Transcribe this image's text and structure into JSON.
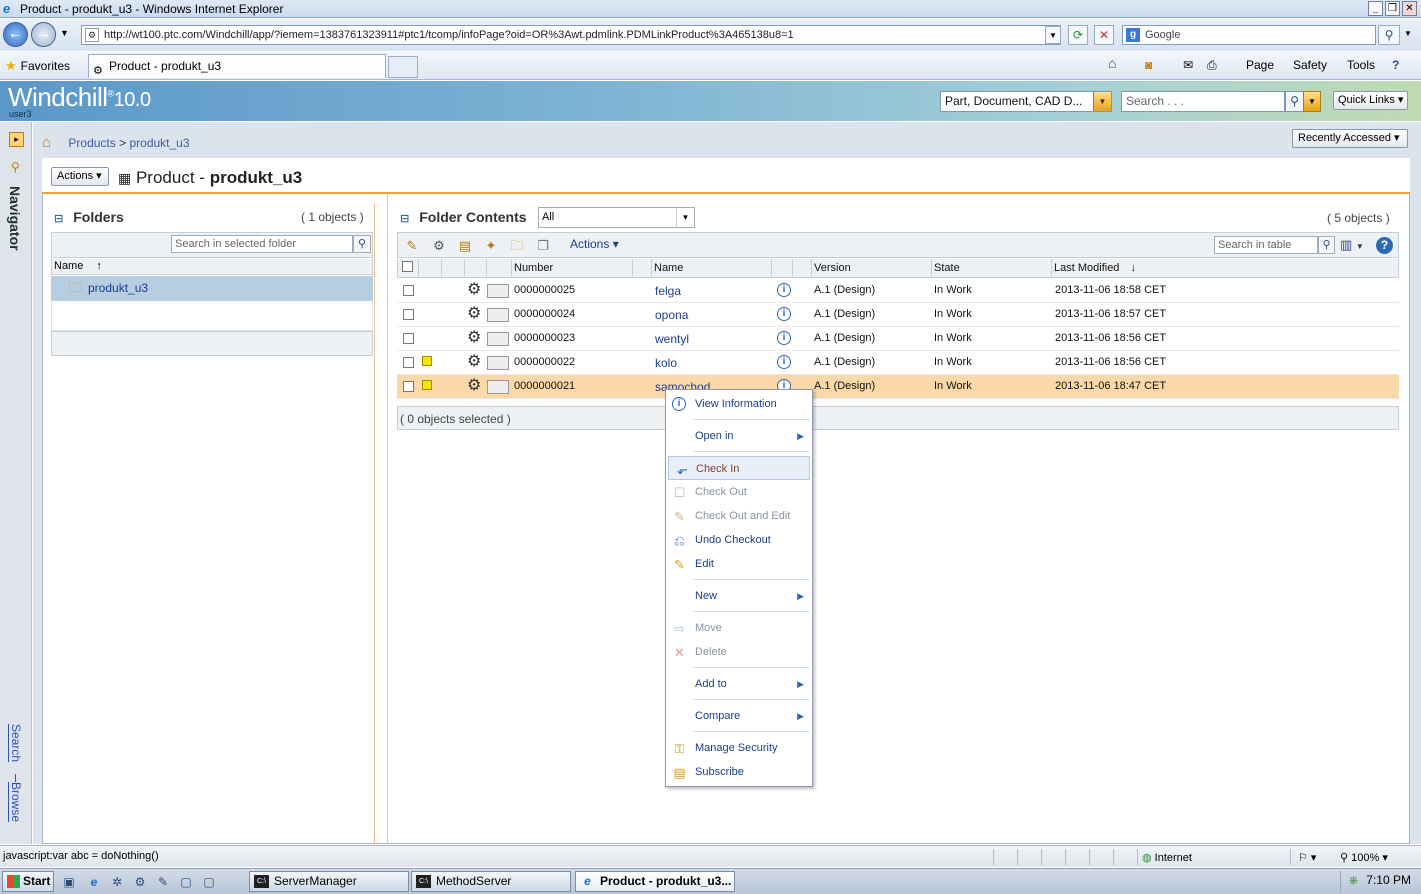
{
  "browser": {
    "window_title": "Product - produkt_u3 - Windows Internet Explorer",
    "url": "http://wt100.ptc.com/Windchill/app/?iemem=1383761323911#ptc1/tcomp/infoPage?oid=OR%3Awt.pdmlink.PDMLinkProduct%3A465138u8=1",
    "search_engine": "Google",
    "favorites_label": "Favorites",
    "tab_title": "Product - produkt_u3",
    "cmd_page": "Page",
    "cmd_safety": "Safety",
    "cmd_tools": "Tools"
  },
  "header": {
    "logo": "Windchill",
    "version": "10.0",
    "user": "user3",
    "type_select": "Part, Document, CAD D...",
    "search_placeholder": "Search . . .",
    "quick_links": "Quick Links"
  },
  "navigator": {
    "title": "Navigator",
    "search_link": "Search",
    "browse_link": "Browse"
  },
  "breadcrumb": {
    "products": "Products",
    "separator": ">",
    "current": "produkt_u3"
  },
  "recently_accessed": "Recently Accessed",
  "page": {
    "actions": "Actions",
    "title_prefix": "Product -",
    "title_name": "produkt_u3"
  },
  "folders": {
    "title": "Folders",
    "count": "( 1 objects )",
    "search_placeholder": "Search in selected folder",
    "col_name": "Name",
    "sort_arrow": "↑",
    "items": [
      "produkt_u3"
    ]
  },
  "contents": {
    "title": "Folder Contents",
    "view": "All",
    "count": "( 5 objects )",
    "actions": "Actions",
    "search_placeholder": "Search in table",
    "columns": {
      "number": "Number",
      "name": "Name",
      "version": "Version",
      "state": "State",
      "last_modified": "Last Modified",
      "sort_arrow": "↓"
    },
    "rows": [
      {
        "number": "0000000025",
        "name": "felga",
        "version": "A.1 (Design)",
        "state": "In Work",
        "modified": "2013-11-06 18:58 CET"
      },
      {
        "number": "0000000024",
        "name": "opona",
        "version": "A.1 (Design)",
        "state": "In Work",
        "modified": "2013-11-06 18:57 CET"
      },
      {
        "number": "0000000023",
        "name": "wentyl",
        "version": "A.1 (Design)",
        "state": "In Work",
        "modified": "2013-11-06 18:56 CET"
      },
      {
        "number": "0000000022",
        "name": "kolo",
        "version": "A.1 (Design)",
        "state": "In Work",
        "modified": "2013-11-06 18:56 CET"
      },
      {
        "number": "0000000021",
        "name": "samochod",
        "version": "A.1 (Design)",
        "state": "In Work",
        "modified": "2013-11-06 18:47 CET"
      }
    ],
    "selected": "( 0 objects selected )"
  },
  "context_menu": {
    "view_information": "View Information",
    "open_in": "Open in",
    "check_in": "Check In",
    "check_out": "Check Out",
    "check_out_edit": "Check Out and Edit",
    "undo_checkout": "Undo Checkout",
    "edit": "Edit",
    "new": "New",
    "move": "Move",
    "delete": "Delete",
    "add_to": "Add to",
    "compare": "Compare",
    "manage_security": "Manage Security",
    "subscribe": "Subscribe"
  },
  "status": {
    "text": "javascript:var abc = doNothing()",
    "zone": "Internet",
    "zoom": "100%"
  },
  "taskbar": {
    "start": "Start",
    "tasks": [
      "ServerManager",
      "MethodServer",
      "Product - produkt_u3..."
    ],
    "clock": "7:10 PM"
  }
}
